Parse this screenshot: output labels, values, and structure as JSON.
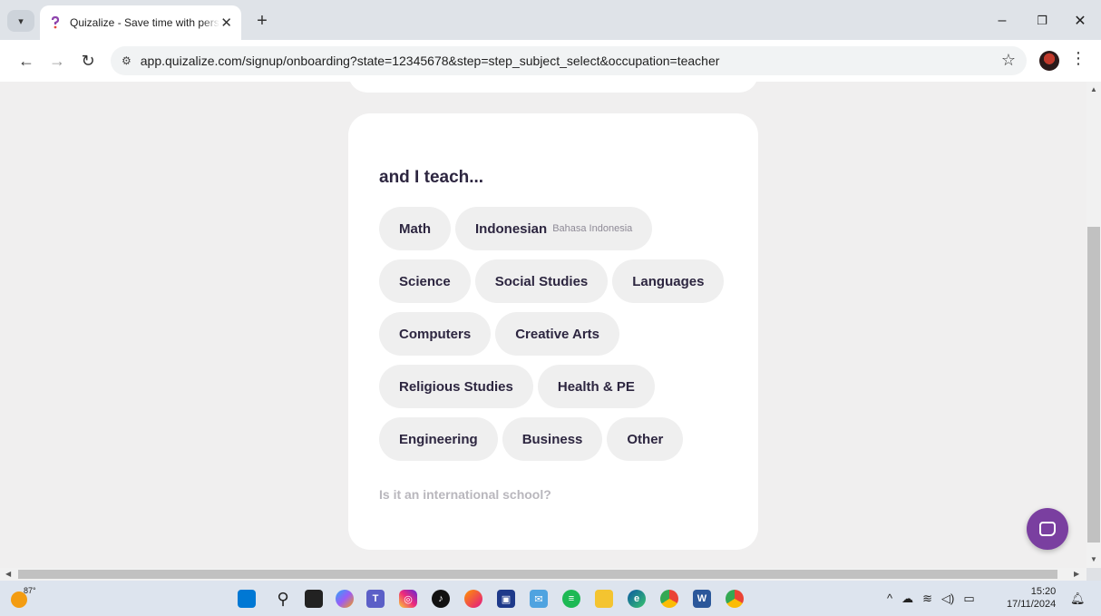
{
  "browser": {
    "tab_title": "Quizalize - Save time with personalised quizzes",
    "tab_close": "✕",
    "new_tab": "+",
    "url": "app.quizalize.com/signup/onboarding?state=12345678&step=step_subject_select&occupation=teacher",
    "window_controls": {
      "minimize": "–",
      "restore": "❐",
      "close": "✕"
    }
  },
  "page": {
    "heading": "and I teach...",
    "subjects": [
      {
        "label": "Math"
      },
      {
        "label": "Indonesian",
        "sub": "Bahasa Indonesia"
      },
      {
        "label": "Science"
      },
      {
        "label": "Social Studies"
      },
      {
        "label": "Languages"
      },
      {
        "label": "Computers"
      },
      {
        "label": "Creative Arts"
      },
      {
        "label": "Religious Studies"
      },
      {
        "label": "Health & PE"
      },
      {
        "label": "Engineering"
      },
      {
        "label": "Business"
      },
      {
        "label": "Other"
      }
    ],
    "international_link": "Is it an international school?"
  },
  "taskbar": {
    "weather_temp": "87°",
    "time": "15:20",
    "date": "17/11/2024",
    "pinned_icons": [
      "windows-start-icon",
      "search-icon",
      "task-view-icon",
      "copilot-icon",
      "teams-icon",
      "instagram-icon",
      "tiktok-icon",
      "firefox-icon",
      "microsoft-store-icon",
      "mail-icon",
      "spotify-icon",
      "file-explorer-icon",
      "edge-icon",
      "chrome-icon",
      "word-icon",
      "chrome-profile-icon"
    ]
  },
  "colors": {
    "chip_bg": "#efefef",
    "chip_text": "#2d2640",
    "page_bg": "#f0efef",
    "chat_launcher": "#7a3fa0"
  }
}
